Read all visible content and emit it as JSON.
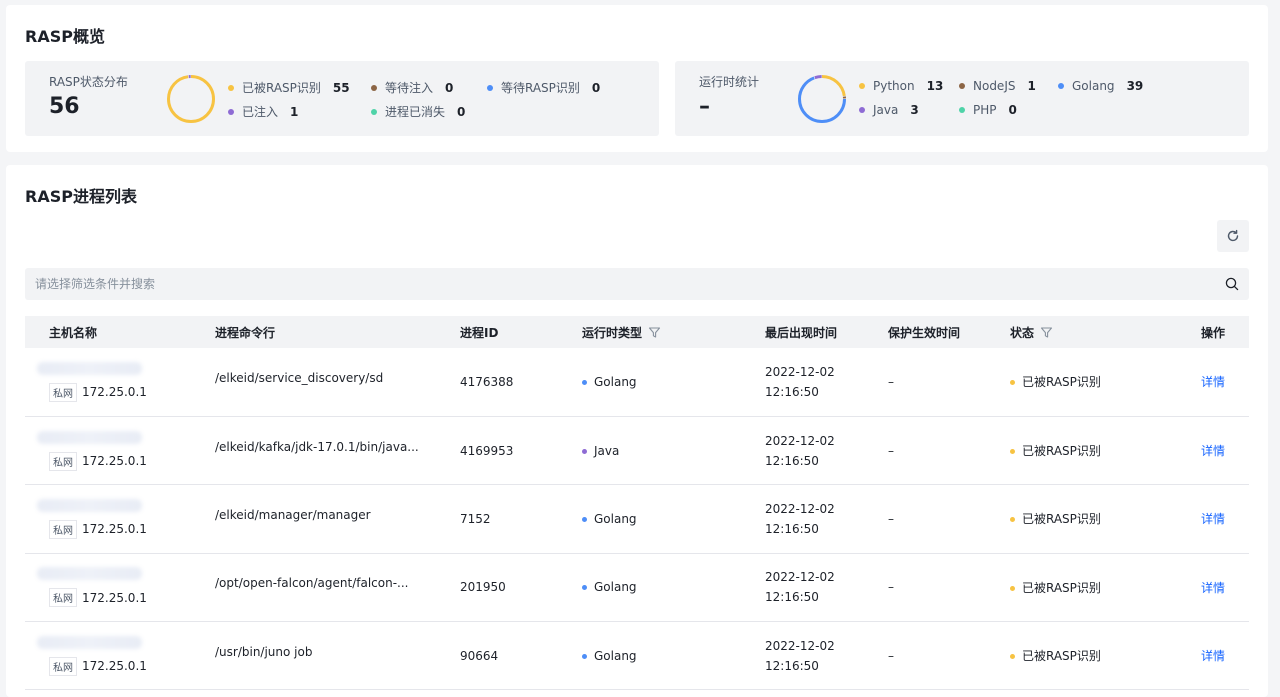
{
  "overview": {
    "title": "RASP概览",
    "status": {
      "label": "RASP状态分布",
      "total": "56",
      "legend": [
        {
          "name": "已被RASP识别",
          "count": "55",
          "color": "#f7c342"
        },
        {
          "name": "等待注入",
          "count": "0",
          "color": "#8c6545"
        },
        {
          "name": "等待RASP识别",
          "count": "0",
          "color": "#4e8ef7"
        },
        {
          "name": "已注入",
          "count": "1",
          "color": "#8e6bd4"
        },
        {
          "name": "进程已消失",
          "count": "0",
          "color": "#4fd3a8"
        }
      ]
    },
    "runtime": {
      "label": "运行时统计",
      "total": "–",
      "legend": [
        {
          "name": "Python",
          "count": "13",
          "color": "#f7c342"
        },
        {
          "name": "NodeJS",
          "count": "1",
          "color": "#8c6545"
        },
        {
          "name": "Golang",
          "count": "39",
          "color": "#4e8ef7"
        },
        {
          "name": "Java",
          "count": "3",
          "color": "#8e6bd4"
        },
        {
          "name": "PHP",
          "count": "0",
          "color": "#4fd3a8"
        }
      ]
    }
  },
  "process_list": {
    "title": "RASP进程列表",
    "search": {
      "placeholder": "请选择筛选条件并搜索"
    },
    "columns": [
      "主机名称",
      "进程命令行",
      "进程ID",
      "运行时类型",
      "最后出现时间",
      "保护生效时间",
      "状态",
      "操作"
    ],
    "rows": [
      {
        "net": "私网",
        "ip": "172.25.0.1",
        "cmd": "/elkeid/service_discovery/sd",
        "pid": "4176388",
        "runtime": "Golang",
        "runtime_color": "#4e8ef7",
        "date": "2022-12-02",
        "time": "12:16:50",
        "protect": "–",
        "status": "已被RASP识别",
        "status_color": "#f7c342",
        "action": "详情"
      },
      {
        "net": "私网",
        "ip": "172.25.0.1",
        "cmd": "/elkeid/kafka/jdk-17.0.1/bin/java...",
        "pid": "4169953",
        "runtime": "Java",
        "runtime_color": "#8e6bd4",
        "date": "2022-12-02",
        "time": "12:16:50",
        "protect": "–",
        "status": "已被RASP识别",
        "status_color": "#f7c342",
        "action": "详情"
      },
      {
        "net": "私网",
        "ip": "172.25.0.1",
        "cmd": "/elkeid/manager/manager",
        "pid": "7152",
        "runtime": "Golang",
        "runtime_color": "#4e8ef7",
        "date": "2022-12-02",
        "time": "12:16:50",
        "protect": "–",
        "status": "已被RASP识别",
        "status_color": "#f7c342",
        "action": "详情"
      },
      {
        "net": "私网",
        "ip": "172.25.0.1",
        "cmd": "/opt/open-falcon/agent/falcon-...",
        "pid": "201950",
        "runtime": "Golang",
        "runtime_color": "#4e8ef7",
        "date": "2022-12-02",
        "time": "12:16:50",
        "protect": "–",
        "status": "已被RASP识别",
        "status_color": "#f7c342",
        "action": "详情"
      },
      {
        "net": "私网",
        "ip": "172.25.0.1",
        "cmd": "/usr/bin/juno job",
        "pid": "90664",
        "runtime": "Golang",
        "runtime_color": "#4e8ef7",
        "date": "2022-12-02",
        "time": "12:16:50",
        "protect": "–",
        "status": "已被RASP识别",
        "status_color": "#f7c342",
        "action": "详情"
      }
    ]
  }
}
